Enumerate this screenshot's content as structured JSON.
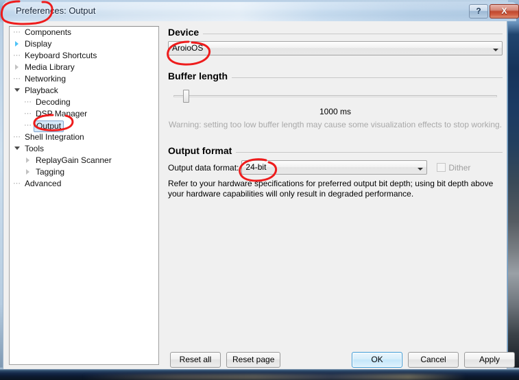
{
  "window": {
    "title": "Preferences: Output",
    "help_button": "?",
    "close_button": "X"
  },
  "sidebar": {
    "items": [
      {
        "label": "Components",
        "indent": 0,
        "twisty": "none",
        "selected": false
      },
      {
        "label": "Display",
        "indent": 0,
        "twisty": "collapsed-blue",
        "selected": false
      },
      {
        "label": "Keyboard Shortcuts",
        "indent": 0,
        "twisty": "none",
        "selected": false
      },
      {
        "label": "Media Library",
        "indent": 0,
        "twisty": "collapsed",
        "selected": false
      },
      {
        "label": "Networking",
        "indent": 0,
        "twisty": "none",
        "selected": false
      },
      {
        "label": "Playback",
        "indent": 0,
        "twisty": "expanded",
        "selected": false
      },
      {
        "label": "Decoding",
        "indent": 1,
        "twisty": "none",
        "selected": false
      },
      {
        "label": "DSP Manager",
        "indent": 1,
        "twisty": "none",
        "selected": false
      },
      {
        "label": "Output",
        "indent": 1,
        "twisty": "none",
        "selected": true
      },
      {
        "label": "Shell Integration",
        "indent": 0,
        "twisty": "none",
        "selected": false
      },
      {
        "label": "Tools",
        "indent": 0,
        "twisty": "expanded",
        "selected": false
      },
      {
        "label": "ReplayGain Scanner",
        "indent": 1,
        "twisty": "collapsed",
        "selected": false
      },
      {
        "label": "Tagging",
        "indent": 1,
        "twisty": "collapsed",
        "selected": false
      },
      {
        "label": "Advanced",
        "indent": 0,
        "twisty": "none",
        "selected": false
      }
    ]
  },
  "content": {
    "device": {
      "group_title": "Device",
      "selected_value": "AroioOS",
      "dropdown_icon": "chevron-down-icon"
    },
    "buffer": {
      "group_title": "Buffer length",
      "value_label": "1000 ms",
      "slider_percent": 3,
      "warning": "Warning: setting too low buffer length may cause some visualization effects to stop working."
    },
    "output_format": {
      "group_title": "Output format",
      "field_label": "Output data format:",
      "selected_value": "24-bit",
      "dropdown_icon": "chevron-down-icon",
      "dither_label": "Dither",
      "dither_checked": false,
      "dither_enabled": false,
      "hint": "Refer to your hardware specifications for preferred output bit depth; using bit depth above your hardware capabilities will only result in degraded performance."
    }
  },
  "buttons": {
    "reset_all": "Reset all",
    "reset_page": "Reset page",
    "ok": "OK",
    "cancel": "Cancel",
    "apply": "Apply"
  },
  "annotations": {
    "color": "#ee1c1c",
    "marks": [
      {
        "name": "title-circle",
        "shape": "ellipse"
      },
      {
        "name": "device-value-circle",
        "shape": "ellipse"
      },
      {
        "name": "output-tree-item-circle",
        "shape": "ellipse"
      },
      {
        "name": "output-format-value-circle",
        "shape": "ellipse"
      }
    ]
  }
}
